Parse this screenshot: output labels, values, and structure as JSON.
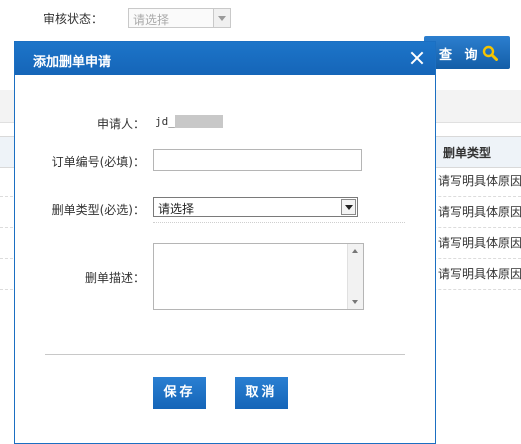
{
  "filter": {
    "status_label": "审核状态：",
    "status_placeholder": "请选择",
    "query_button": "查 询",
    "query_icon": "search-icon"
  },
  "table": {
    "column_header": "删单类型",
    "rows": [
      "请写明具体原因",
      "请写明具体原因",
      "请写明具体原因",
      "请写明具体原因"
    ]
  },
  "dialog": {
    "title": "添加删单申请",
    "close_icon": "close-icon",
    "applicant_label": "申请人：",
    "applicant_value": "jd_",
    "order_no_label": "订单编号(必填)：",
    "order_no_value": "",
    "delete_type_label": "删单类型(必选)：",
    "delete_type_selected": "请选择",
    "description_label": "删单描述：",
    "description_value": "",
    "save_button": "保存",
    "cancel_button": "取消"
  },
  "colors": {
    "primary_blue": "#1565b8",
    "header_blue": "#1d75c9"
  }
}
